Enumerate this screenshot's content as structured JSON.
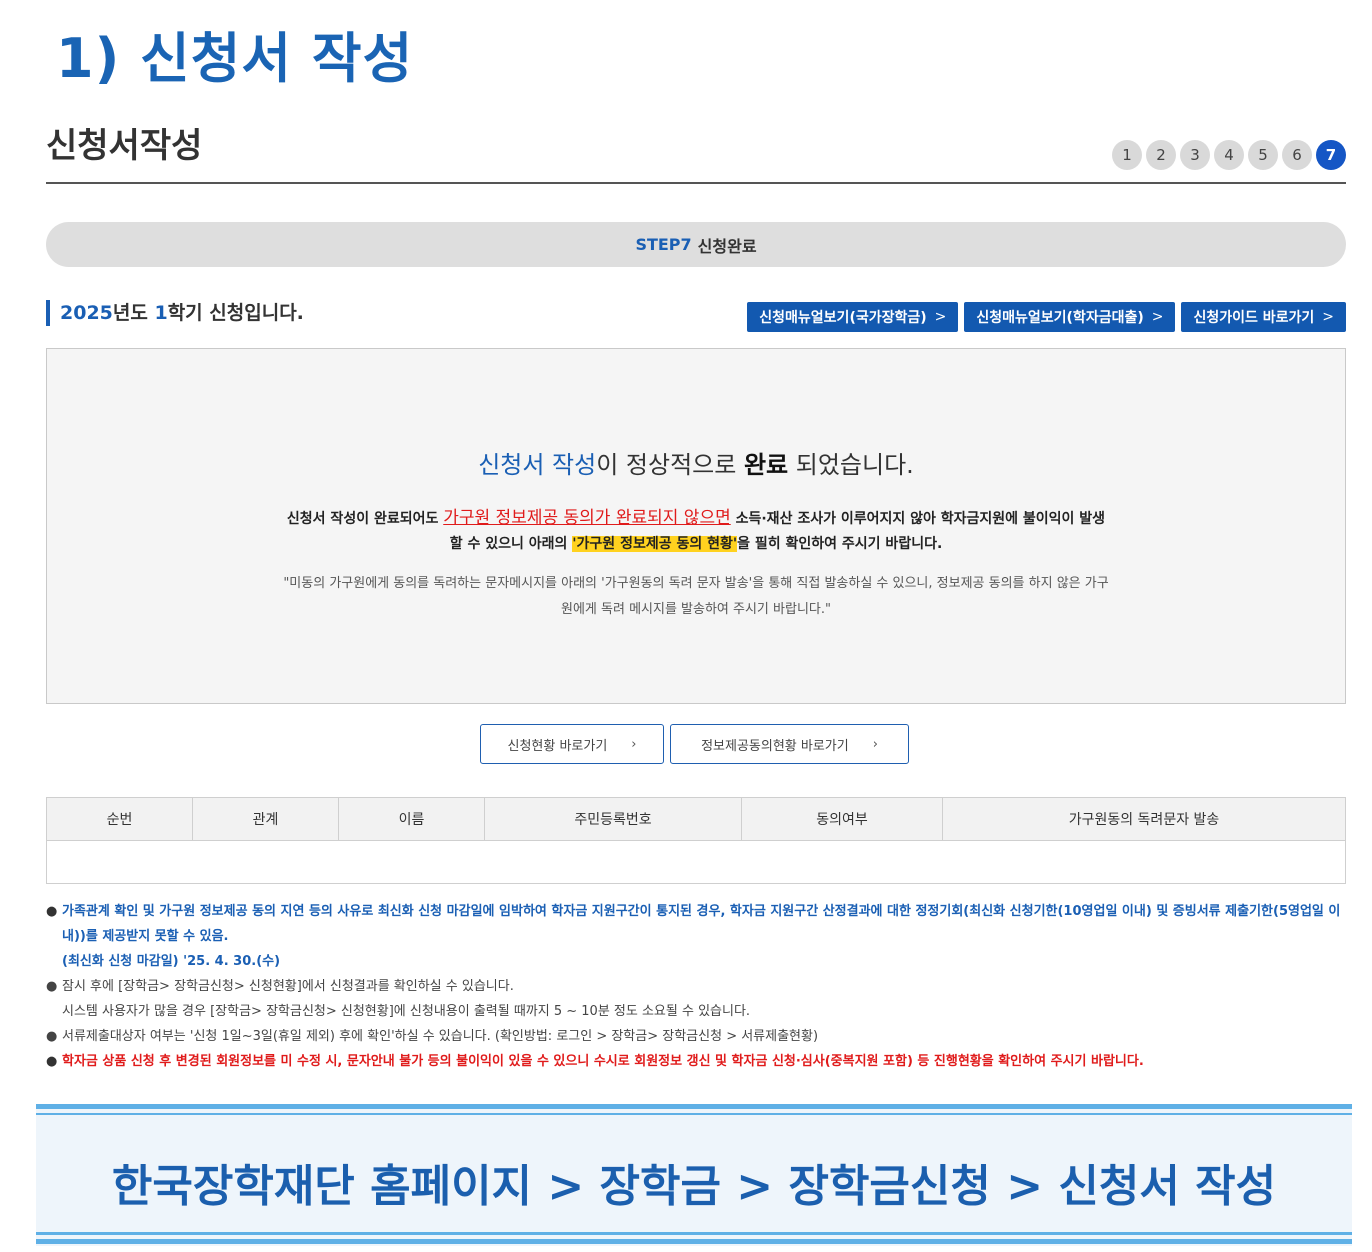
{
  "hero_title": "1) 신청서 작성",
  "page_title": "신청서작성",
  "steps": [
    "1",
    "2",
    "3",
    "4",
    "5",
    "6",
    "7"
  ],
  "active_step": "7",
  "step_banner": {
    "code": "STEP7",
    "label": "신청완료"
  },
  "semester": {
    "year": "2025",
    "year_suffix": "년도 ",
    "term": "1",
    "term_suffix": "학기 신청입니다."
  },
  "guide_buttons": [
    {
      "label": "신청매뉴얼보기(국가장학금)",
      "chevron": ">"
    },
    {
      "label": "신청매뉴얼보기(학자금대출)",
      "chevron": ">"
    },
    {
      "label": "신청가이드 바로가기",
      "chevron": ">"
    }
  ],
  "completion": {
    "head_blue": "신청서 작성",
    "head_mid": "이 정상적으로 ",
    "head_strong": "완료",
    "head_end": " 되었습니다.",
    "body_1": "신청서 작성이 완료되어도 ",
    "body_red": "가구원 정보제공 동의가 완료되지 않으면",
    "body_2": " 소득·재산 조사가 이루어지지 않아 학자금지원에 불이익이 발생할 수 있으니 아래의 ",
    "body_highlight": "'가구원 정보제공 동의 현황'",
    "body_3": "을 필히 확인하여 주시기 바랍니다.",
    "note": "\"미동의 가구원에게 동의를 독려하는 문자메시지를 아래의 '가구원동의 독려 문자 발송'을 통해 직접 발송하실 수 있으니, 정보제공 동의를 하지 않은 가구원에게 독려 메시지를 발송하여 주시기 바랍니다.\""
  },
  "nav_buttons": [
    {
      "label": "신청현황 바로가기",
      "chevron": "›"
    },
    {
      "label": "정보제공동의현황 바로가기",
      "chevron": "›"
    }
  ],
  "table": {
    "headers": [
      "순번",
      "관계",
      "이름",
      "주민등록번호",
      "동의여부",
      "가구원동의 독려문자 발송"
    ]
  },
  "notes": {
    "bullet": "●",
    "n1_text": "가족관계 확인 및 가구원 정보제공 동의 지연 등의 사유로 최신화 신청 마감일에 임박하여 학자금 지원구간이 통지된 경우, 학자금 지원구간 산정결과에 대한 정정기회(최신화 신청기한(10영업일 이내) 및 증빙서류 제출기한(5영업일 이내))를 제공받지 못할 수 있음.",
    "n1_deadline": "(최신화 신청 마감일) '25. 4. 30.(수)",
    "n2_line1": "잠시 후에 [장학금> 장학금신청> 신청현황]에서 신청결과를 확인하실 수 있습니다.",
    "n2_line2": "시스템 사용자가 많을 경우 [장학금> 장학금신청> 신청현황]에 신청내용이 출력될 때까지 5 ~ 10분 정도 소요될 수 있습니다.",
    "n3": "서류제출대상자 여부는 '신청 1일~3일(휴일 제외) 후에 확인'하실 수 있습니다. (확인방법: 로그인 > 장학금> 장학금신청 > 서류제출현황)",
    "n4": "학자금 상품 신청 후 변경된 회원정보를 미 수정 시, 문자안내 불가 등의 불이익이 있을 수 있으니 수시로 회원정보 갱신 및 학자금 신청·심사(중복지원 포함) 등 진행현황을 확인하여 주시기 바랍니다."
  },
  "footer_path": "한국장학재단 홈페이지 > 장학금 > 장학금신청 > 신청서 작성"
}
